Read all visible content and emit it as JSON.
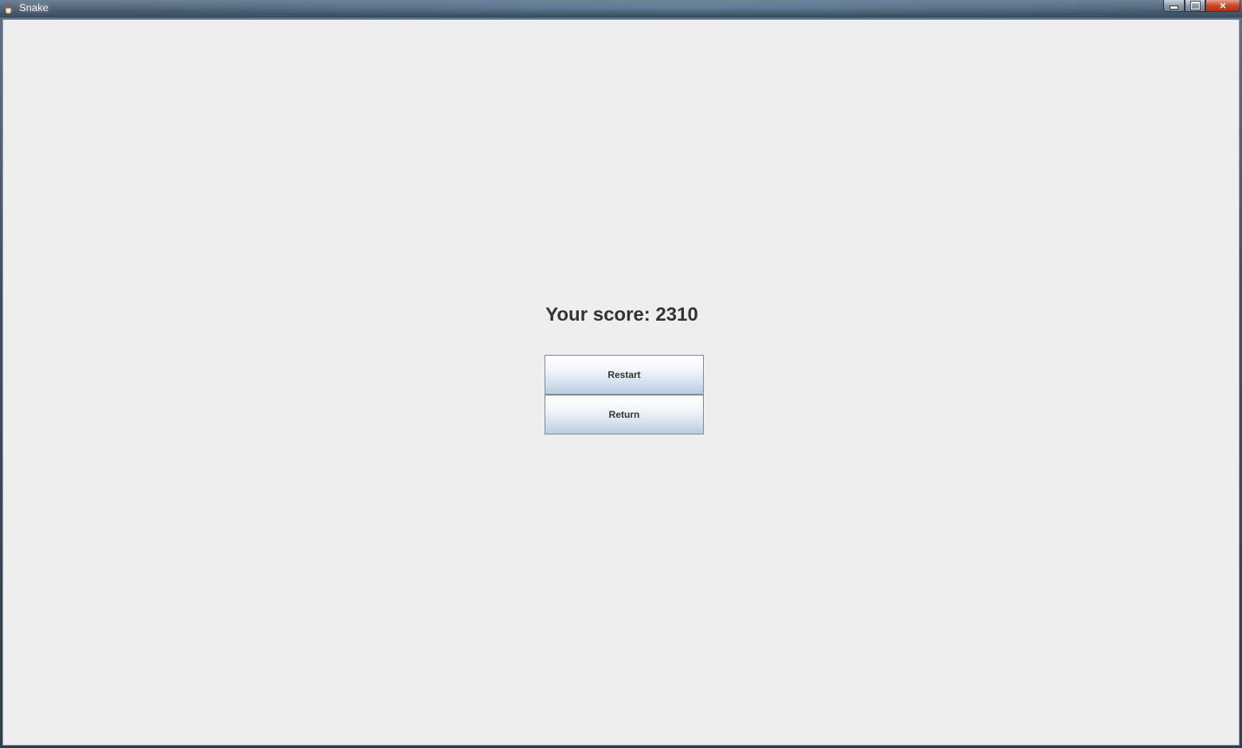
{
  "window": {
    "title": "Snake"
  },
  "title_buttons": {
    "close_glyph": "✕"
  },
  "main": {
    "score_text": "Your score: 2310",
    "restart_label": "Restart",
    "return_label": "Return"
  },
  "colors": {
    "content_background": "#eeeeee",
    "text": "#333333",
    "close_button": "#c9452c"
  }
}
